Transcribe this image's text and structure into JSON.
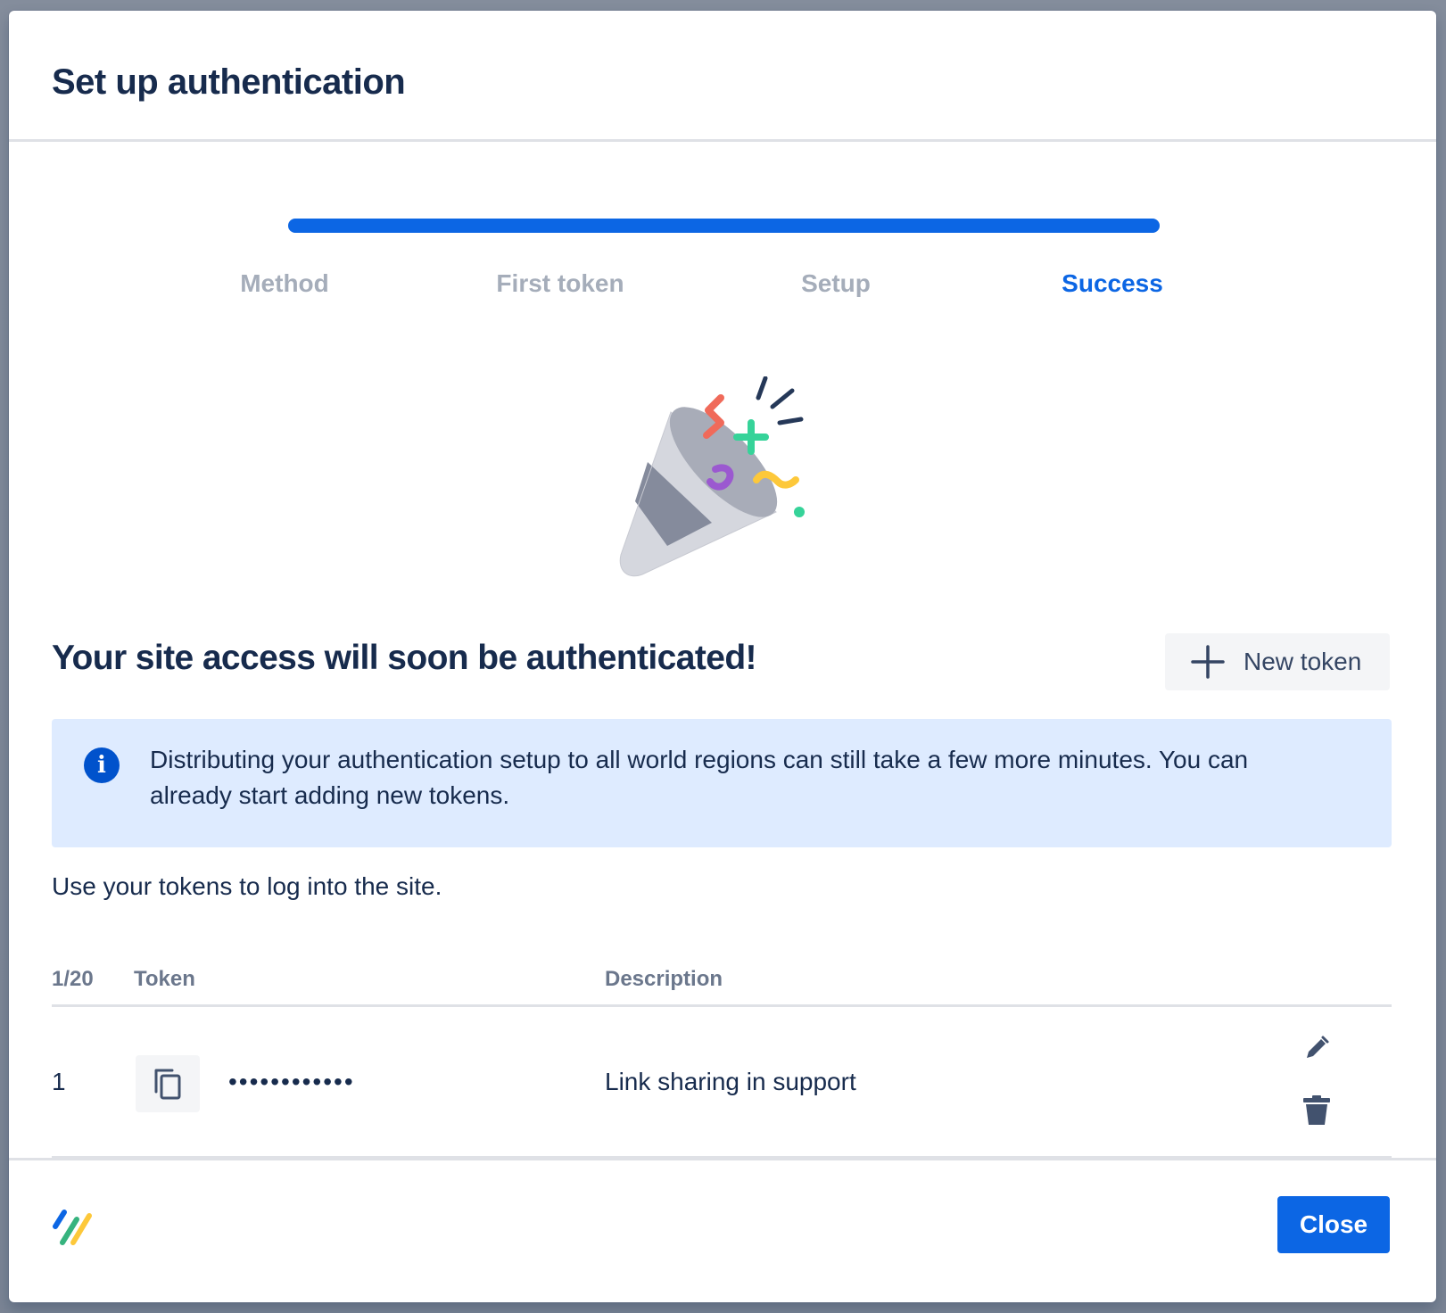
{
  "modal": {
    "title": "Set up authentication"
  },
  "wizard": {
    "progress_percent": 100,
    "progress_color": "#0c66e4",
    "steps": [
      {
        "label": "Method",
        "state": "done"
      },
      {
        "label": "First token",
        "state": "done"
      },
      {
        "label": "Setup",
        "state": "done"
      },
      {
        "label": "Success",
        "state": "active"
      }
    ]
  },
  "illustration": {
    "icon": "party-popper-icon"
  },
  "content": {
    "headline": "Your site access will soon be authenticated!",
    "new_token_label": "New token",
    "info_message": "Distributing your authentication setup to all world regions can still take a few more minutes. You can already start adding new tokens.",
    "helper_text": "Use your tokens to log into the site."
  },
  "tokens_table": {
    "count_label": "1/20",
    "columns": {
      "token": "Token",
      "description": "Description"
    },
    "rows": [
      {
        "index": "1",
        "token_masked": "••••••••••••",
        "description": "Link sharing in support"
      }
    ]
  },
  "footer": {
    "close_label": "Close"
  },
  "colors": {
    "primary": "#0c66e4",
    "info_background": "#deebff",
    "text": "#172b4d",
    "muted": "#a5adba"
  }
}
